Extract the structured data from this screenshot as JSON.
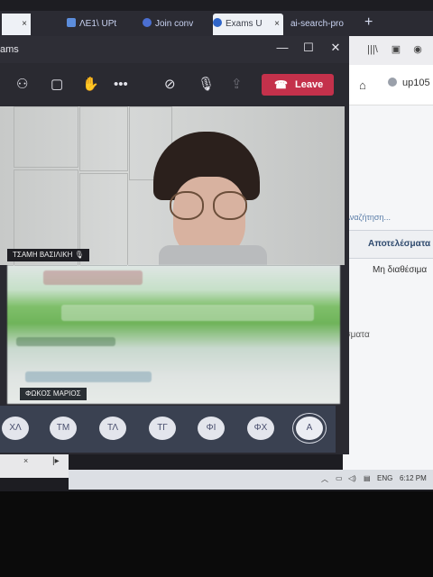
{
  "browser": {
    "tabs": [
      {
        "label": "ΛΕ1\\ UPt",
        "active": false
      },
      {
        "label": "Join conv",
        "active": false
      },
      {
        "label": "Exams U",
        "active": true
      },
      {
        "label": "ai-search-pro",
        "active": false
      }
    ],
    "new_tab": "+",
    "close_tab": "×",
    "user": "up105",
    "search_hint": "Αναζήτηση...",
    "results_header": "Αποτελέσματα",
    "unavailable": "Μη διαθέσιμα",
    "results_fragment": "λέσματα",
    "colors": {
      "accent": "#c4314b"
    }
  },
  "teams": {
    "title": "ams",
    "leave_label": "Leave",
    "participants": [
      {
        "name": "ΤΣΑΜΗ ΒΑΣΙΛΙΚΗ"
      },
      {
        "name": "ΦΩΚΟΣ ΜΑΡΙΟΣ"
      }
    ],
    "initials": [
      "ΧΛ",
      "ΤΜ",
      "ΤΛ",
      "ΤΓ",
      "ΦΙ",
      "ΦΧ",
      "Α"
    ]
  },
  "taskbar": {
    "language": "ENG",
    "time": "6:12 PM"
  }
}
